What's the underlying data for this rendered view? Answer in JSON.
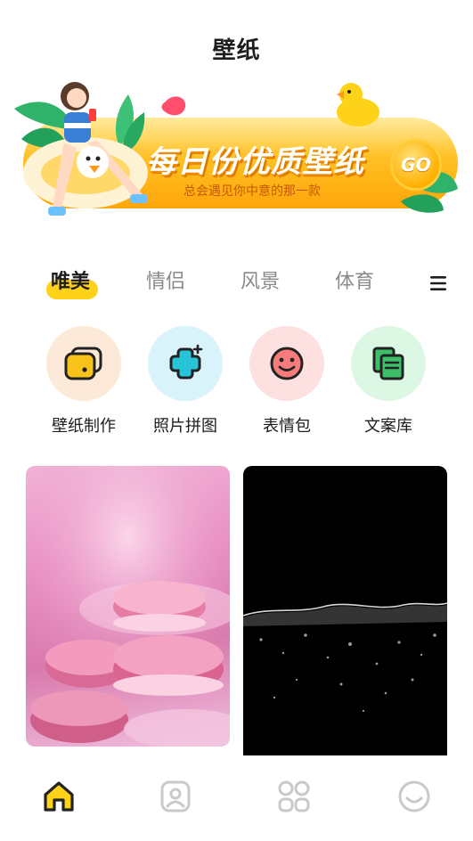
{
  "header": {
    "title": "壁纸"
  },
  "banner": {
    "headline": "每日份优质壁纸",
    "subtitle": "总会遇见你中意的那一款",
    "go_label": "GO"
  },
  "tabs": [
    {
      "label": "唯美",
      "active": true
    },
    {
      "label": "情侣",
      "active": false
    },
    {
      "label": "风景",
      "active": false
    },
    {
      "label": "体育",
      "active": false
    }
  ],
  "features": [
    {
      "label": "壁纸制作",
      "icon": "wallpaper-make-icon",
      "bg": "#fde9d7",
      "accent": "#f7c21a"
    },
    {
      "label": "照片拼图",
      "icon": "photo-collage-icon",
      "bg": "#d9f3fb",
      "accent": "#27c3d8"
    },
    {
      "label": "表情包",
      "icon": "emoji-icon",
      "bg": "#fde0e0",
      "accent": "#f87c7c"
    },
    {
      "label": "文案库",
      "icon": "copywriting-icon",
      "bg": "#dcf7e3",
      "accent": "#3dbf6a"
    }
  ],
  "wallpapers": [
    {
      "name": "pink macarons"
    },
    {
      "name": "dark water splash"
    }
  ],
  "bottom_nav": [
    {
      "icon": "home-icon",
      "active": true
    },
    {
      "icon": "profile-card-icon",
      "active": false
    },
    {
      "icon": "grid-apps-icon",
      "active": false
    },
    {
      "icon": "smile-icon",
      "active": false
    }
  ],
  "colors": {
    "accent": "#ffd21a",
    "nav_inactive": "#c9c9c9"
  }
}
